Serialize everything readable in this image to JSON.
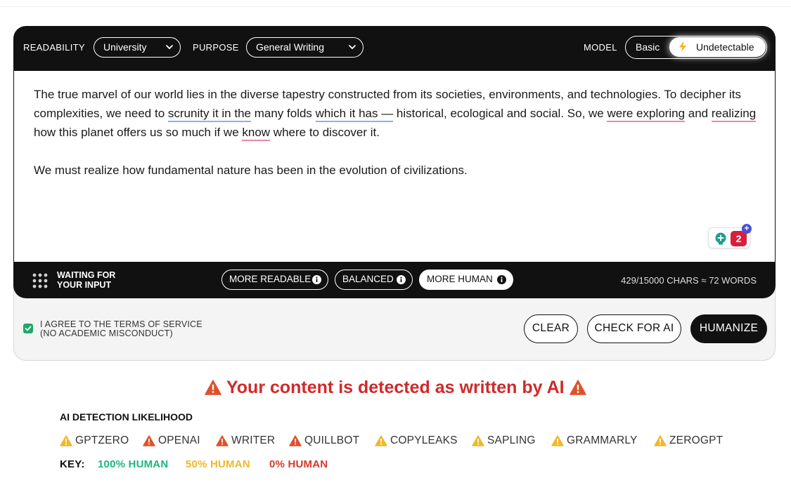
{
  "toolbar": {
    "readability_label": "READABILITY",
    "readability_value": "University",
    "purpose_label": "PURPOSE",
    "purpose_value": "General Writing",
    "model_label": "MODEL",
    "model_options": [
      "Basic",
      "Undetectable"
    ],
    "model_selected": "Undetectable"
  },
  "editor": {
    "para1": {
      "t1": "The true marvel of our world lies in the diverse tapestry constructed from its societies, environments, and technologies. To decipher its complexities, we need to ",
      "u1": "scrunity it in the",
      "t2": " many folds ",
      "u2": "which it has —",
      "t3": " historical, ecological and social. So, we ",
      "u3": "were exploring",
      "t4": " and ",
      "u4": "realizing",
      "t5": " how this planet offers us so much if we ",
      "u5": "know",
      "t6": " where to discover it."
    },
    "para2": "We must realize how fundamental nature has been in the evolution of civilizations.",
    "suggestion_count": "2",
    "suggestion_plus": "+"
  },
  "status": {
    "line1": "WAITING FOR",
    "line2": "YOUR INPUT"
  },
  "modes": [
    {
      "label": "MORE READABLE"
    },
    {
      "label": "BALANCED"
    },
    {
      "label": "MORE HUMAN"
    }
  ],
  "active_mode": "MORE HUMAN",
  "counter": "429/15000 CHARS ≈ 72 WORDS",
  "terms": {
    "checked": true,
    "line1": "I AGREE TO THE TERMS OF SERVICE",
    "line2": "(NO ACADEMIC MISCONDUCT)"
  },
  "actions": {
    "clear": "CLEAR",
    "check": "CHECK FOR AI",
    "humanize": "HUMANIZE"
  },
  "result": {
    "alert": "Your content is detected as written by AI",
    "likelihood_title": "AI DETECTION LIKELIHOOD",
    "detectors": [
      {
        "name": "GPTZERO",
        "level": "50%"
      },
      {
        "name": "OPENAI",
        "level": "0%"
      },
      {
        "name": "WRITER",
        "level": "0%"
      },
      {
        "name": "QUILLBOT",
        "level": "0%"
      },
      {
        "name": "COPYLEAKS",
        "level": "50%"
      },
      {
        "name": "SAPLING",
        "level": "50%"
      },
      {
        "name": "GRAMMARLY",
        "level": "50%"
      },
      {
        "name": "ZEROGPT",
        "level": "50%"
      }
    ],
    "key_label": "KEY:",
    "key": [
      {
        "label": "100% HUMAN",
        "color": "#1db67a"
      },
      {
        "label": "50% HUMAN",
        "color": "#f0b82a"
      },
      {
        "label": "0% HUMAN",
        "color": "#d7382a"
      }
    ]
  },
  "colors": {
    "warn_yellow": "#f0b82a",
    "warn_red": "#e0512a",
    "alert_red": "#d02a2a",
    "check_green": "#1fa86a"
  }
}
